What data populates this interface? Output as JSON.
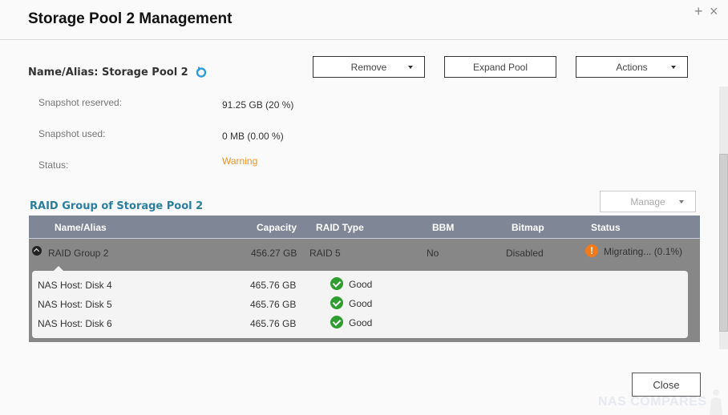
{
  "window": {
    "title": "Storage Pool 2 Management",
    "plus_icon": "+",
    "close_icon": "×"
  },
  "pool": {
    "name_alias_label": "Name/Alias: Storage Pool 2",
    "refresh_icon": "refresh-icon"
  },
  "toolbar": {
    "remove_label": "Remove",
    "expand_label": "Expand Pool",
    "actions_label": "Actions"
  },
  "info": [
    {
      "label": "Snapshot reserved:",
      "value": "91.25 GB (20 %)"
    },
    {
      "label": "Snapshot used:",
      "value": "0 MB (0.00 %)"
    },
    {
      "label": "Status:",
      "value": "Warning"
    }
  ],
  "raid_section": {
    "title": "RAID Group of Storage Pool 2",
    "manage_label": "Manage",
    "columns": [
      "Name/Alias",
      "Capacity",
      "RAID Type",
      "BBM",
      "Bitmap",
      "Status"
    ],
    "group": {
      "name": "RAID Group 2",
      "capacity": "456.27 GB",
      "raid_type": "RAID 5",
      "bbm": "No",
      "bitmap": "Disabled",
      "status": "Migrating... (0.1%)",
      "status_icon": "!"
    },
    "disks": [
      {
        "name": "NAS Host: Disk 4",
        "capacity": "465.76 GB",
        "status": "Good"
      },
      {
        "name": "NAS Host: Disk 5",
        "capacity": "465.76 GB",
        "status": "Good"
      },
      {
        "name": "NAS Host: Disk 6",
        "capacity": "465.76 GB",
        "status": "Good"
      }
    ]
  },
  "footer": {
    "close_label": "Close",
    "watermark": "NAS COMPARES"
  },
  "colors": {
    "warning": "#f7901e",
    "section_title": "#2a7fa0",
    "table_header": "#7f8696",
    "good": "#2e9e2e"
  }
}
